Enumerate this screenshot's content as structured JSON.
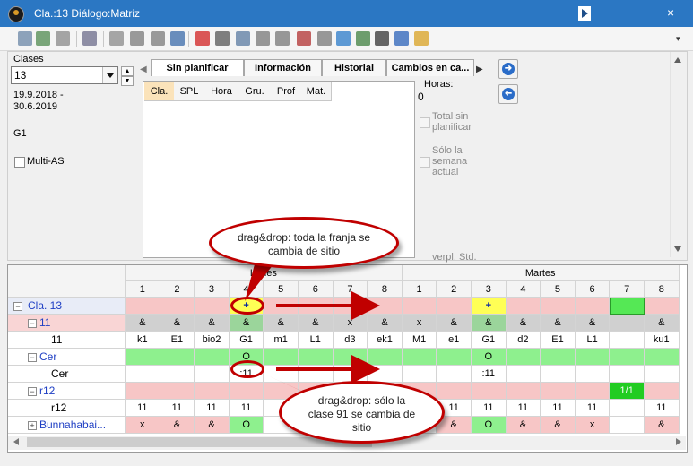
{
  "window": {
    "title": "Cla.:13  Diálogo:Matriz",
    "close_glyph": "×"
  },
  "toolbar": {
    "icons": [
      "add-row-icon",
      "edit-row-icon",
      "pin-icon",
      "import-icon",
      "tool-a-icon",
      "lock-icon",
      "link-icon",
      "transfer-icon",
      "pushpin-red-icon",
      "filter-list-icon",
      "timetable-icon",
      "clock-icon",
      "stack-icon",
      "delete-icon",
      "list-icon",
      "refresh-icon",
      "calculator-icon",
      "graduation-cap-icon",
      "edit-pencil-icon",
      "settings-gear-icon"
    ],
    "menu_glyph": "▾"
  },
  "left": {
    "label": "Clases",
    "combo_value": "13",
    "date_range_line1": "19.9.2018 -",
    "date_range_line2": "30.6.2019",
    "group": "G1",
    "multi_as": "Multi-AS"
  },
  "tabs": [
    {
      "label": "Sin planificar"
    },
    {
      "label": "Información"
    },
    {
      "label": "Historial"
    },
    {
      "label": "Cambios en ca..."
    }
  ],
  "inner_grid": {
    "columns": [
      "Cla.",
      "SPL",
      "Hora",
      "Gru.",
      "Prof",
      "Mat."
    ]
  },
  "right_panel": {
    "horas_label": "Horas:",
    "horas_value": "0",
    "total_sin": "Total sin planificar",
    "solo_semana": "Sólo la semana actual",
    "verpl": "verpl. Std."
  },
  "matrix": {
    "days": [
      "Lunes",
      "Martes"
    ],
    "periods": [
      "1",
      "2",
      "3",
      "4",
      "5",
      "6",
      "7",
      "8",
      "1",
      "2",
      "3",
      "4",
      "5",
      "6",
      "7",
      "8"
    ],
    "rows": [
      {
        "label": "Cla. 13",
        "indent": 0,
        "expander": "⊟",
        "link": true,
        "cells": [
          "",
          "",
          "",
          "+",
          "",
          "",
          "",
          "",
          "",
          "",
          "+",
          "",
          "",
          "",
          "",
          ""
        ]
      },
      {
        "label": "11",
        "indent": 1,
        "expander": "⊟",
        "link": true,
        "cells": [
          "&",
          "&",
          "&",
          "&",
          "&",
          "&",
          "x",
          "&",
          "x",
          "&",
          "&",
          "&",
          "&",
          "&",
          "",
          "&"
        ]
      },
      {
        "label": "11",
        "indent": 2,
        "expander": "",
        "link": false,
        "cells": [
          "k1",
          "E1",
          "bio2",
          "G1",
          "m1",
          "L1",
          "d3",
          "ek1",
          "M1",
          "e1",
          "G1",
          "d2",
          "E1",
          "L1",
          "",
          "ku1"
        ]
      },
      {
        "label": "Cer",
        "indent": 1,
        "expander": "⊟",
        "link": true,
        "cells": [
          "",
          "",
          "",
          "O",
          "",
          "",
          "",
          "",
          "",
          "",
          "O",
          "",
          "",
          "",
          "",
          ""
        ]
      },
      {
        "label": "Cer",
        "indent": 2,
        "expander": "",
        "link": false,
        "cells": [
          "",
          "",
          "",
          ":11",
          "",
          "",
          "",
          "",
          "",
          "",
          ":11",
          "",
          "",
          "",
          "",
          ""
        ]
      },
      {
        "label": "r12",
        "indent": 1,
        "expander": "⊟",
        "link": true,
        "cells": [
          "",
          "",
          "",
          "",
          "",
          "",
          "",
          "",
          "",
          "",
          "",
          "",
          "",
          "",
          "1/1",
          ""
        ]
      },
      {
        "label": "r12",
        "indent": 2,
        "expander": "",
        "link": false,
        "cells": [
          "11",
          "11",
          "11",
          "11",
          "",
          "",
          "",
          "",
          "",
          "11",
          "11",
          "11",
          "11",
          "11",
          "",
          "11"
        ]
      },
      {
        "label": "Bunnahabai...",
        "indent": 1,
        "expander": "⊞",
        "link": true,
        "cells": [
          "x",
          "&",
          "&",
          "O",
          "",
          "",
          "",
          "",
          "",
          "&",
          "O",
          "&",
          "&",
          "x",
          "",
          "&"
        ]
      }
    ]
  },
  "callouts": {
    "top": "drag&drop: toda la franja se cambia de sitio",
    "bottom": "drag&drop: sólo la clase 91 se cambia de sitio"
  },
  "colors": {
    "titlebar": "#2b77c3",
    "pink": "#f7c6c6",
    "green": "#8ef08e",
    "yellow": "#ffff55",
    "link_blue": "#1f3fc4",
    "callout_red": "#c00000"
  }
}
